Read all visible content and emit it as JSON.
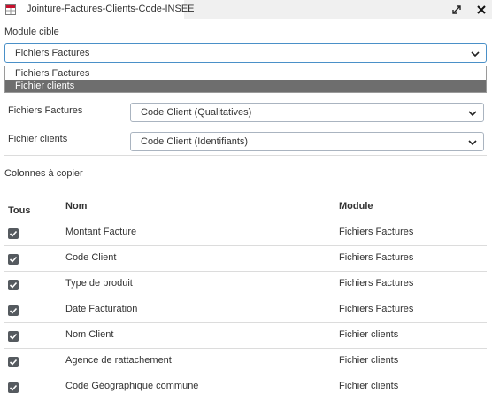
{
  "window": {
    "title": "Jointure-Factures-Clients-Code-INSEE",
    "expand_icon": "expand-arrows-icon",
    "close_icon": "close-x-icon"
  },
  "target_module": {
    "label": "Module cible",
    "selected": "Fichiers Factures",
    "options": [
      "Fichiers Factures",
      "Fichier clients"
    ],
    "highlighted_option": "Fichier clients"
  },
  "join_fields": [
    {
      "module": "Fichiers Factures",
      "selected": "Code Client (Qualitatives)"
    },
    {
      "module": "Fichier clients",
      "selected": "Code Client (Identifiants)"
    }
  ],
  "columns_section": {
    "label": "Colonnes à copier",
    "headers": {
      "all": "Tous",
      "name": "Nom",
      "module": "Module"
    },
    "rows": [
      {
        "checked": true,
        "name": "Montant Facture",
        "module": "Fichiers Factures"
      },
      {
        "checked": true,
        "name": "Code Client",
        "module": "Fichiers Factures"
      },
      {
        "checked": true,
        "name": "Type de produit",
        "module": "Fichiers Factures"
      },
      {
        "checked": true,
        "name": "Date Facturation",
        "module": "Fichiers Factures"
      },
      {
        "checked": true,
        "name": "Nom Client",
        "module": "Fichier clients"
      },
      {
        "checked": true,
        "name": "Agence de rattachement",
        "module": "Fichier clients"
      },
      {
        "checked": true,
        "name": "Code Géographique commune",
        "module": "Fichier clients"
      }
    ]
  },
  "colors": {
    "checkbox": "#555a5f",
    "highlight": "#6e6e6e",
    "focus_border": "#4a90c8"
  }
}
